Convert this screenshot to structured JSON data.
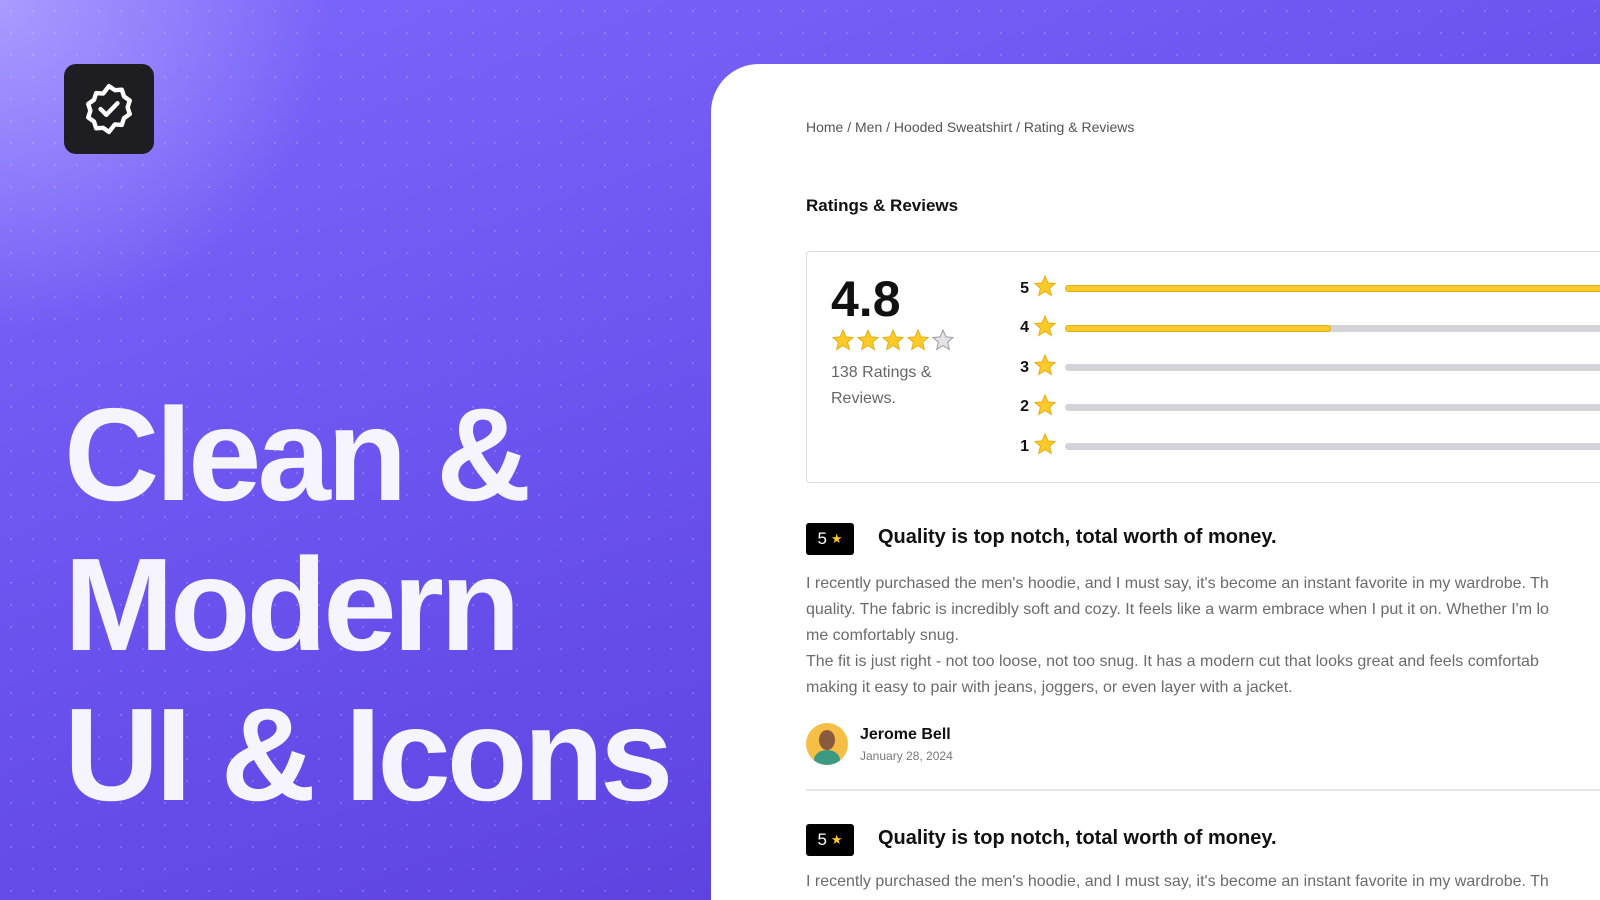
{
  "hero": {
    "lines": [
      "Clean &",
      "Modern",
      "UI & Icons"
    ]
  },
  "logo": {
    "icon": "verified-badge-icon"
  },
  "colors": {
    "accent": "#6a52ee",
    "star": "#fdca2a",
    "bar_empty": "#d4d4d8"
  },
  "breadcrumb": "Home / Men / Hooded Sweatshirt / Rating & Reviews",
  "section_title": "Ratings & Reviews",
  "summary": {
    "score": "4.8",
    "stars_filled": 4,
    "stars_total": 5,
    "count_text": "138 Ratings & Reviews.",
    "distribution": [
      {
        "label": "5",
        "fraction": 1.0
      },
      {
        "label": "4",
        "fraction": 0.38
      },
      {
        "label": "3",
        "fraction": 0
      },
      {
        "label": "2",
        "fraction": 0
      },
      {
        "label": "1",
        "fraction": 0
      }
    ]
  },
  "reviews": [
    {
      "rating": "5",
      "title": "Quality is top notch, total worth of money.",
      "body": "I recently purchased the  men's hoodie, and I must say, it's become an instant favorite in my wardrobe. Th\nquality. The fabric is incredibly soft and cozy. It feels like a warm embrace when I put it on. Whether I'm lo\nme comfortably snug.\nThe fit is just right - not too loose, not too snug. It has a modern cut that looks great and feels comfortab\nmaking it easy to pair with jeans, joggers, or even layer with a jacket.",
      "author": "Jerome Bell",
      "date": "January 28, 2024"
    },
    {
      "rating": "5",
      "title": "Quality is top notch, total worth of money.",
      "body": "I recently purchased the  men's hoodie, and I must say, it's become an instant favorite in my wardrobe. Th"
    }
  ]
}
